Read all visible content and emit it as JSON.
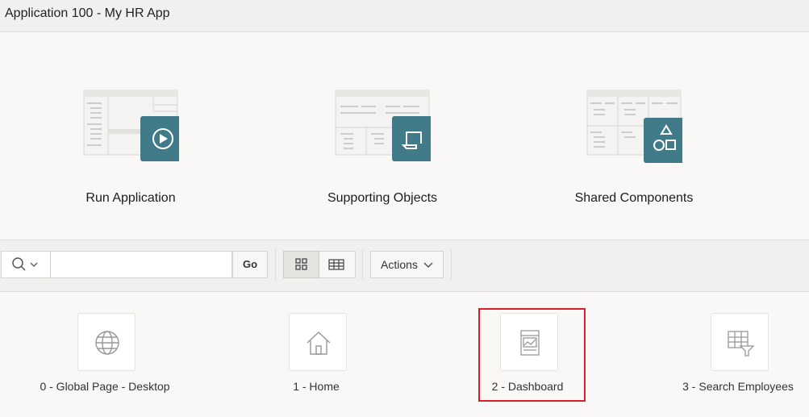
{
  "app": {
    "title": "Application 100 - My HR App"
  },
  "hero": {
    "tiles": [
      {
        "label": "Run Application",
        "icon": "play-icon"
      },
      {
        "label": "Supporting Objects",
        "icon": "scroll-icon"
      },
      {
        "label": "Shared Components",
        "icon": "shapes-icon"
      }
    ],
    "accent": "#417a89"
  },
  "toolbar": {
    "search_placeholder": "",
    "search_value": "",
    "go_label": "Go",
    "actions_label": "Actions"
  },
  "pages": [
    {
      "label": "0 - Global Page - Desktop",
      "icon": "globe-icon"
    },
    {
      "label": "1 - Home",
      "icon": "home-icon"
    },
    {
      "label": "2 - Dashboard",
      "icon": "dashboard-icon",
      "highlighted": true
    },
    {
      "label": "3 - Search Employees",
      "icon": "grid-filter-icon"
    }
  ]
}
